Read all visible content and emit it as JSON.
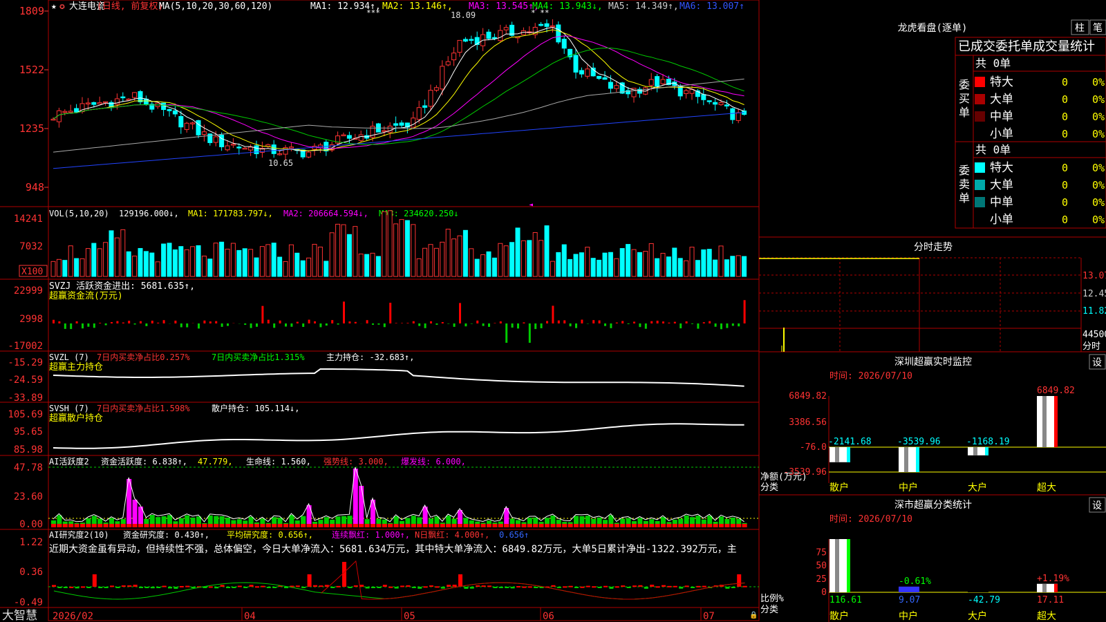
{
  "stock": {
    "name": "大连电瓷",
    "period": "(日线, 前复权)",
    "ma_spec": "MA(5,10,20,30,60,120)",
    "star": "★",
    "star2": "✪"
  },
  "ma_labels": [
    {
      "text": "MA1: 12.934↑,",
      "color": "#ffffff"
    },
    {
      "text": "MA2: 13.146↑,",
      "color": "#ffff00"
    },
    {
      "text": "MA3: 13.545↑,",
      "color": "#ff00ff"
    },
    {
      "text": "MA4: 13.943↓,",
      "color": "#00ff00"
    },
    {
      "text": "MA5: 14.349↑,",
      "color": "#cccccc"
    },
    {
      "text": "MA6: 13.007↑",
      "color": "#3355ff"
    }
  ],
  "price_axis": [
    "1809",
    "1522",
    "1235",
    "948"
  ],
  "price_annotations": {
    "high": "18.09",
    "low": "10.65"
  },
  "vol": {
    "label": "VOL(5,10,20)",
    "value": "129196.000↓,",
    "ma1": "MA1: 171783.797↓,",
    "ma2": "MA2: 206664.594↓,",
    "ma3": "MA3: 234620.250↓",
    "axis": [
      "14241",
      "7032",
      "X100"
    ]
  },
  "svzj": {
    "label": "SVZJ  活跃资金进出: 5681.635↑,",
    "sub": "超赢资金流(万元)",
    "axis": [
      "22999",
      "2998",
      "-17002"
    ]
  },
  "svzl": {
    "label": "SVZL (7)",
    "p1": "7日内买卖净占比0.257%",
    "p2": "7日内买卖净占比1.315%",
    "p3": "主力持仓: -32.683↑,",
    "sub": "超赢主力持仓",
    "axis": [
      "-15.29",
      "-24.59",
      "-33.89"
    ]
  },
  "svsh": {
    "label": "SVSH (7)",
    "p1": "7日内买卖净占比1.598%",
    "p2": "散户持仓: 105.114↓,",
    "sub": "超赢散户持仓",
    "axis": [
      "105.69",
      "95.65",
      "85.98"
    ]
  },
  "ai_active": {
    "label": "AI活跃度2",
    "p1": "资金活跃度: 6.838↑,",
    "p2": "47.779,",
    "p3": "生命线: 1.560,",
    "p4": "强势线: 3.000,",
    "p5": "爆发线: 6.000,",
    "axis": [
      "47.78",
      "23.60",
      "0.00"
    ]
  },
  "ai_research": {
    "label": "AI研究度2(10)",
    "p1": "资金研究度: 0.430↑,",
    "p2": "平均研究度: 0.656↑,",
    "p3": "连续飘红: 1.000↑,",
    "p4": "N日飘红: 4.000↑,",
    "p5": "0.656↑",
    "axis": [
      "1.22",
      "0.36",
      "-0.49"
    ],
    "comment": "近期大资金虽有异动，但持续性不强，总体偏空，今日大单净流入：5681.634万元，其中特大单净流入：6849.82万元，大单5日累计净出-1322.392万元，主"
  },
  "date_axis": [
    "2026/02",
    "04",
    "05",
    "06",
    "07"
  ],
  "brand": "大智慧",
  "right": {
    "title": "龙虎看盘(逐单)",
    "btn_col": "柱",
    "btn_pen": "笔",
    "table_title": "已成交委托单成交量统计",
    "buy_label": "委买单",
    "sell_label": "委卖单",
    "buy_total": "共 0单",
    "sell_total": "共 0单",
    "buy_rows": [
      {
        "name": "特大",
        "count": "0",
        "pct": "0%",
        "color": "#ff0000"
      },
      {
        "name": "大单",
        "count": "0",
        "pct": "0%",
        "color": "#aa0000"
      },
      {
        "name": "中单",
        "count": "0",
        "pct": "0%",
        "color": "#660000"
      },
      {
        "name": "小单",
        "count": "0",
        "pct": "0%",
        "color": ""
      }
    ],
    "sell_rows": [
      {
        "name": "特大",
        "count": "0",
        "pct": "0%",
        "color": "#00ffff"
      },
      {
        "name": "大单",
        "count": "0",
        "pct": "0%",
        "color": "#00aaaa"
      },
      {
        "name": "中单",
        "count": "0",
        "pct": "0%",
        "color": "#007777"
      },
      {
        "name": "小单",
        "count": "0",
        "pct": "0%",
        "color": ""
      }
    ],
    "fenshi_title": "分时走势",
    "fenshi_axis": [
      "13.07",
      "12.45",
      "11.82",
      "44500"
    ],
    "fenshi_unit": "分时",
    "monitor_title": "深圳超赢实时监控",
    "monitor_time": "时间: 2026/07/10",
    "monitor_btn": "设",
    "monitor_axis": [
      "6849.82",
      "3386.56",
      "-76.0",
      "-3539.96"
    ],
    "monitor_ylabel": "净额(万元)",
    "monitor_xlabel": "分类",
    "stats_title": "深市超赢分类统计",
    "stats_time": "时间: 2026/07/10",
    "stats_btn": "设",
    "stats_axis": [
      "75",
      "50",
      "25",
      "0"
    ],
    "stats_ylabel": "比例%",
    "stats_xlabel": "分类"
  },
  "chart_data": [
    {
      "type": "bar",
      "title": "深圳超赢实时监控",
      "ylabel": "净额(万元)",
      "categories": [
        "散户",
        "中户",
        "大户",
        "超大"
      ],
      "values": [
        -2141.68,
        -3539.96,
        -1168.19,
        6849.82
      ],
      "ylim": [
        -3539.96,
        6849.82
      ]
    },
    {
      "type": "bar",
      "title": "深市超赢分类统计",
      "ylabel": "比例%",
      "categories": [
        "散户",
        "中户",
        "大户",
        "超大"
      ],
      "values": [
        116.61,
        -0.61,
        -42.79,
        1.19
      ],
      "bottom_labels": [
        "116.61",
        "9.07",
        "-42.79",
        "17.11"
      ],
      "top_labels": [
        "",
        "-0.61%",
        "",
        "+1.19%"
      ],
      "ylim": [
        0,
        100
      ]
    }
  ]
}
